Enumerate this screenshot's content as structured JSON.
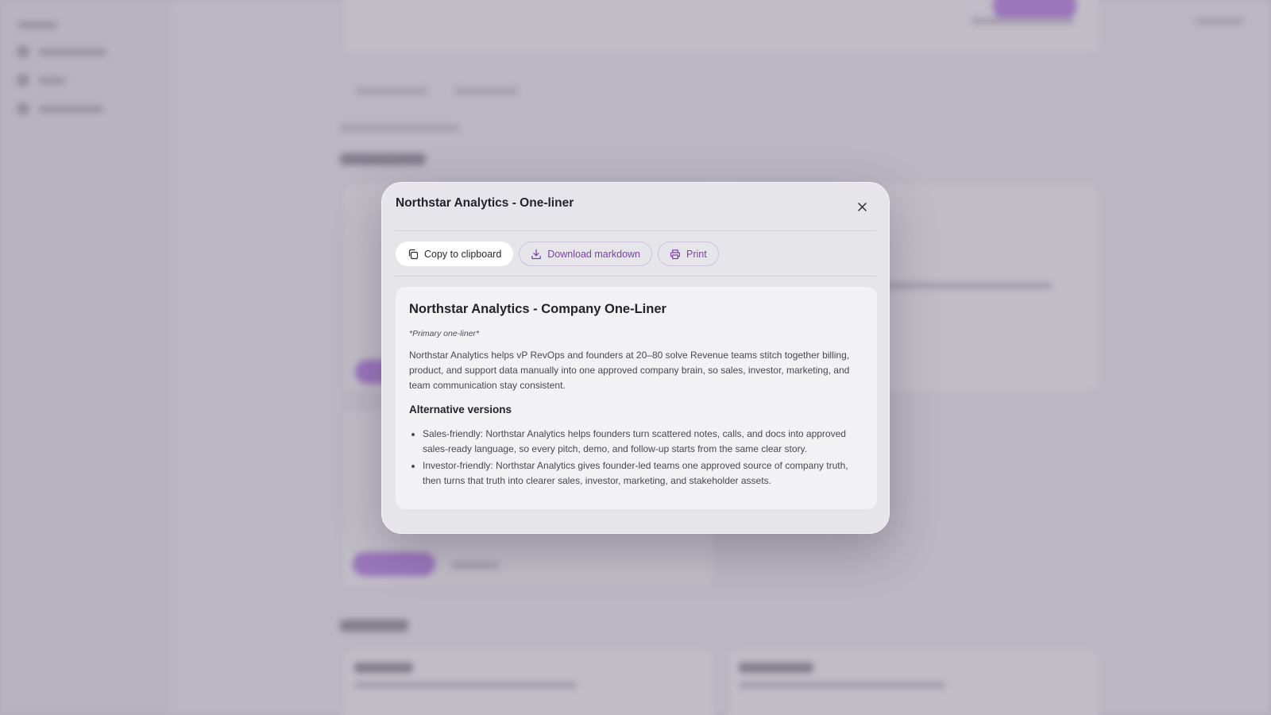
{
  "modal": {
    "title": "Northstar Analytics - One-liner",
    "actions": {
      "copy_label": "Copy to clipboard",
      "download_label": "Download markdown",
      "print_label": "Print"
    },
    "document": {
      "title": "Northstar Analytics - Company One-Liner",
      "subtitle": "*Primary one-liner*",
      "primary": "Northstar Analytics helps vP RevOps and founders at 20–80 solve Revenue teams stitch together billing, product, and support data manually into one approved company brain, so sales, investor, marketing, and team communication stay consistent.",
      "alternatives_heading": "Alternative versions",
      "alternatives": [
        "Sales-friendly: Northstar Analytics helps founders turn scattered notes, calls, and docs into approved sales-ready language, so every pitch, demo, and follow-up starts from the same clear story.",
        "Investor-friendly: Northstar Analytics gives founder-led teams one approved source of company truth, then turns that truth into clearer sales, investor, marketing, and stakeholder assets."
      ]
    }
  },
  "icons": {
    "close": "close-icon",
    "copy": "copy-icon",
    "download": "download-icon",
    "print": "printer-icon"
  },
  "colors": {
    "accent": "#7a3fb0",
    "modal_bg": "#e6e5e9",
    "content_bg": "#f2f1f4",
    "overlay": "rgba(120,112,132,0.42)"
  }
}
